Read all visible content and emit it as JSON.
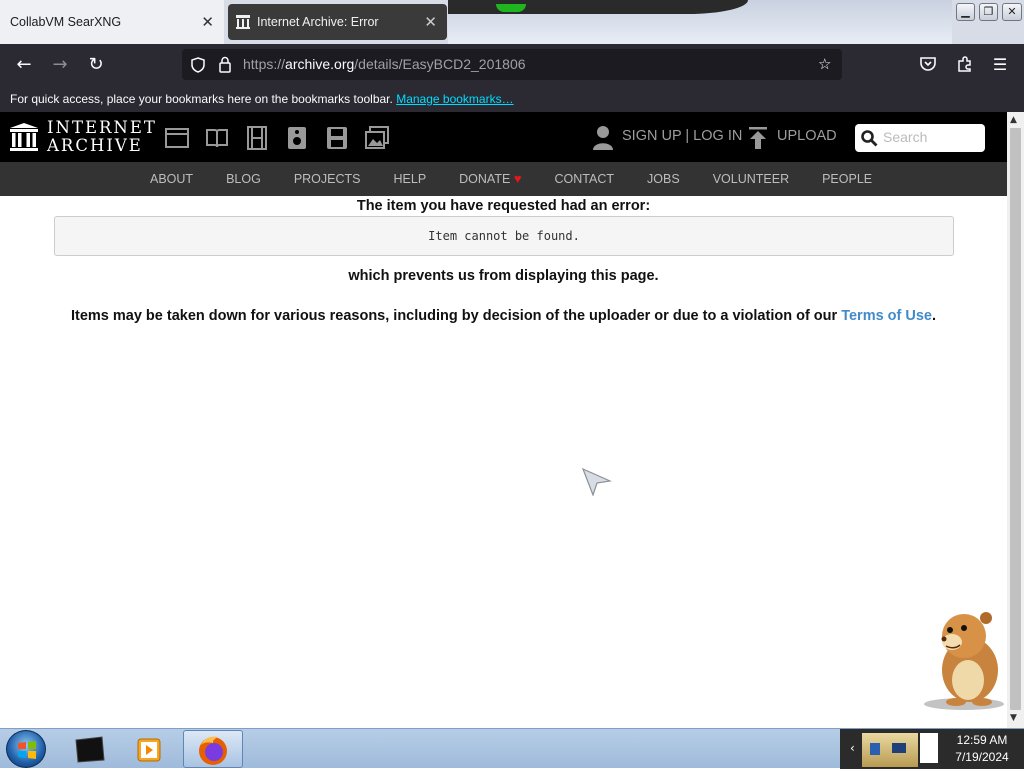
{
  "browser": {
    "tabs": [
      {
        "title": "CollabVM SearXNG",
        "active": false
      },
      {
        "title": "Internet Archive: Error",
        "active": true
      }
    ],
    "url_prefix": "https://",
    "url_host": "archive.org",
    "url_path": "/details/EasyBCD2_201806",
    "bookmarks_hint": "For quick access, place your bookmarks here on the bookmarks toolbar.",
    "bookmarks_link": "Manage bookmarks…"
  },
  "ia": {
    "logo_line1": "INTERNET",
    "logo_line2": "ARCHIVE",
    "account": "SIGN UP | LOG IN",
    "upload": "UPLOAD",
    "search_placeholder": "Search",
    "nav": [
      "ABOUT",
      "BLOG",
      "PROJECTS",
      "HELP",
      "DONATE",
      "CONTACT",
      "JOBS",
      "VOLUNTEER",
      "PEOPLE"
    ]
  },
  "error": {
    "title": "The item you have requested had an error:",
    "message": "Item cannot be found.",
    "sub": "which prevents us from displaying this page.",
    "reason": "Items may be taken down for various reasons, including by decision of the uploader or due to a violation of our",
    "terms_link": "Terms of Use",
    "period": "."
  },
  "taskbar": {
    "time": "12:59 AM",
    "date": "7/19/2024"
  },
  "colors": {
    "link": "#428bca",
    "bookmark_link": "#00ddff",
    "donate_heart": "#e4171b"
  }
}
